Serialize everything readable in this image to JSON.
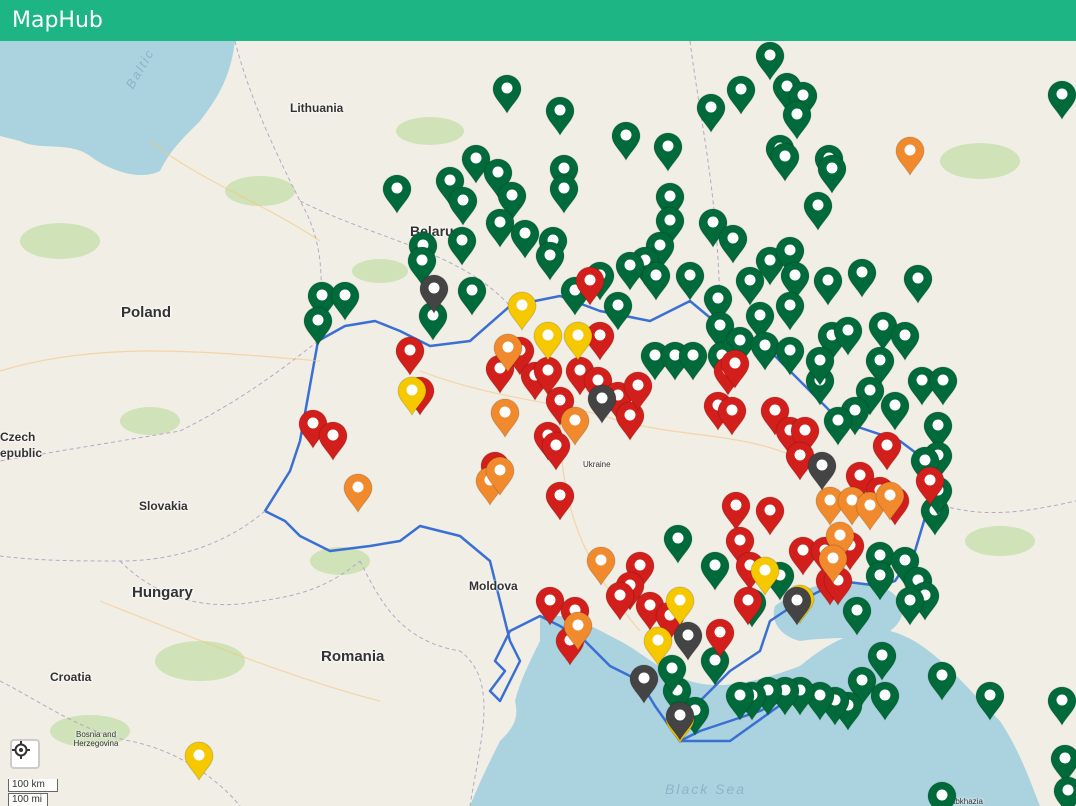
{
  "app": {
    "title": "MapHub"
  },
  "labels": {
    "baltic": "Baltic",
    "lithuania": "Lithuania",
    "belarus": "Belarus",
    "poland": "Poland",
    "czech": "Czech",
    "czech2": "epublic",
    "slovakia": "Slovakia",
    "hungary": "Hungary",
    "moldova": "Moldova",
    "romania": "Romania",
    "croatia": "Croatia",
    "bosnia": "Bosnia and Herzegovina",
    "ukraine": "Ukraine",
    "black_sea": "Black Sea",
    "abkhazia": "Abkhazia"
  },
  "scale": {
    "km": "100 km",
    "mi": "100 mi"
  },
  "colors": {
    "header": "#1db584",
    "green": "#006a3a",
    "red": "#d21f1b",
    "orange": "#f08a2c",
    "yellow": "#f5c800",
    "gray": "#444444",
    "border": "#3a6fd3",
    "water": "#aad3df",
    "land": "#f1eee6"
  },
  "icons": {
    "locate": "crosshair-icon",
    "pin": "map-pin-icon"
  }
}
